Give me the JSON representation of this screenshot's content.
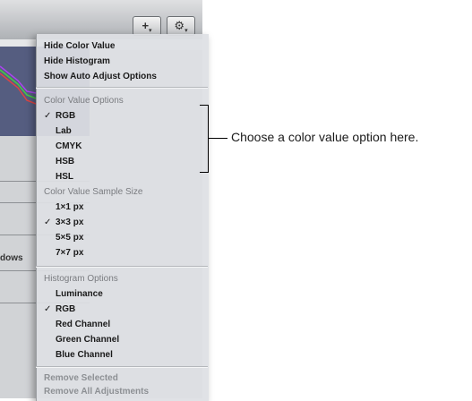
{
  "toolbar": {
    "plus_label": "+",
    "gear_label": "⚙",
    "caret": "▾"
  },
  "side_label": "dows",
  "menu": {
    "top_items": [
      "Hide Color Value",
      "Hide Histogram",
      "Show Auto Adjust Options"
    ],
    "color_value_header": "Color Value Options",
    "color_values": [
      "RGB",
      "Lab",
      "CMYK",
      "HSB",
      "HSL"
    ],
    "color_value_selected": "RGB",
    "sample_size_header": "Color Value Sample Size",
    "sample_sizes": [
      "1×1 px",
      "3×3 px",
      "5×5 px",
      "7×7 px"
    ],
    "sample_size_selected": "3×3 px",
    "histogram_header": "Histogram Options",
    "histogram_options": [
      "Luminance",
      "RGB",
      "Red Channel",
      "Green Channel",
      "Blue Channel"
    ],
    "histogram_selected": "RGB",
    "bottom_items": [
      "Remove Selected",
      "Remove All Adjustments"
    ],
    "check_mark": "✓"
  },
  "callout_text": "Choose a color value option here."
}
